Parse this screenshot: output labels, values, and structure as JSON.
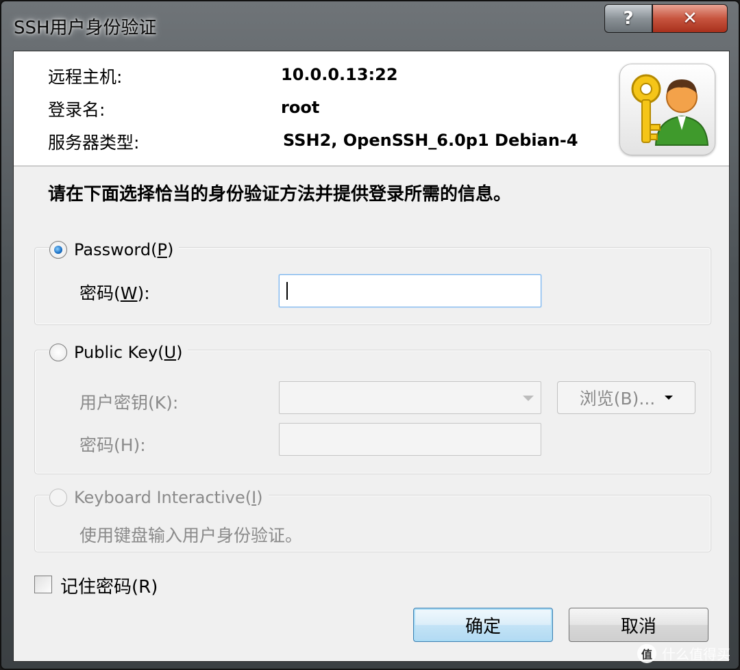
{
  "window": {
    "title": "SSH用户身份验证",
    "help_glyph": "?",
    "close_glyph": "✕"
  },
  "host_info": {
    "host_label": "远程主机:",
    "host_value": "10.0.0.13:22",
    "login_label": "登录名:",
    "login_value": "root",
    "server_type_label": "服务器类型:",
    "server_type_value": "SSH2, OpenSSH_6.0p1 Debian-4"
  },
  "instruction": "请在下面选择恰当的身份验证方法并提供登录所需的信息。",
  "password_group": {
    "radio_label_prefix": "Password(",
    "radio_label_key": "P",
    "radio_label_suffix": ")",
    "checked": true,
    "field_label_prefix": "密码(",
    "field_label_key": "W",
    "field_label_suffix": "):",
    "value": ""
  },
  "public_key_group": {
    "radio_label_prefix": "Public Key(",
    "radio_label_key": "U",
    "radio_label_suffix": ")",
    "checked": false,
    "user_key_label": "用户密钥(K):",
    "passphrase_label": "密码(H):",
    "browse_label": "浏览(B)...",
    "user_key_value": "",
    "passphrase_value": ""
  },
  "keyboard_group": {
    "radio_label_prefix": "Keyboard Interactive(",
    "radio_label_key": "I",
    "radio_label_suffix": ")",
    "checked": false,
    "description": "使用键盘输入用户身份验证。"
  },
  "remember": {
    "label": "记住密码(R)",
    "checked": false
  },
  "buttons": {
    "ok": "确定",
    "cancel": "取消"
  },
  "watermark": {
    "icon_text": "值",
    "text": "什么值得买"
  },
  "colors": {
    "selected_radio": "#1a6fc4",
    "default_button_border": "#3c7fb1",
    "close_button": "#c7553f"
  }
}
